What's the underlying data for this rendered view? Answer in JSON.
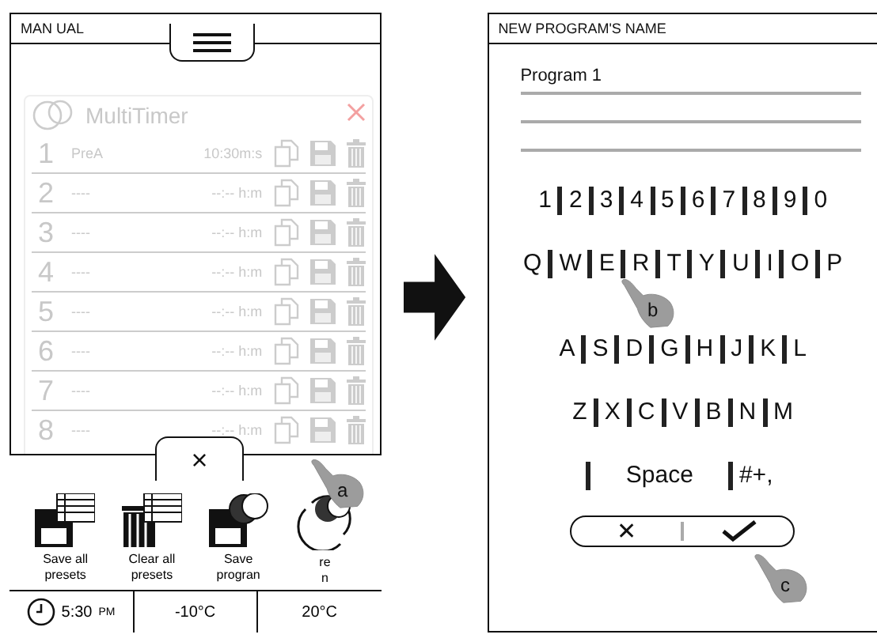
{
  "left_screen": {
    "title": "MAN UAL",
    "timer_card": {
      "title": "MultiTimer",
      "rows": [
        {
          "number": "1",
          "name": "PreA",
          "time": "10:30m:s"
        },
        {
          "number": "2",
          "name": "----",
          "time": "--:-- h:m"
        },
        {
          "number": "3",
          "name": "----",
          "time": "--:-- h:m"
        },
        {
          "number": "4",
          "name": "----",
          "time": "--:-- h:m"
        },
        {
          "number": "5",
          "name": "----",
          "time": "--:-- h:m"
        },
        {
          "number": "6",
          "name": "----",
          "time": "--:-- h:m"
        },
        {
          "number": "7",
          "name": "----",
          "time": "--:-- h:m"
        },
        {
          "number": "8",
          "name": "----",
          "time": "--:-- h:m"
        }
      ]
    },
    "drawer": {
      "close": "×",
      "actions": [
        {
          "kind": "save-presets",
          "lines": [
            "Save all",
            "presets"
          ]
        },
        {
          "kind": "clear-presets",
          "lines": [
            "Clear all",
            "presets"
          ]
        },
        {
          "kind": "save-program",
          "lines": [
            "Save",
            "progran"
          ]
        },
        {
          "kind": "restore",
          "lines": [
            "re",
            "n"
          ]
        }
      ]
    },
    "status_bar": {
      "time": "5:30",
      "time_suffix": "PM",
      "temp_1": "-10°C",
      "temp_2": "20°C"
    }
  },
  "right_screen": {
    "title": "NEW PROGRAM'S NAME",
    "name_value": "Program 1",
    "key_rows": [
      [
        "1",
        "2",
        "3",
        "4",
        "5",
        "6",
        "7",
        "8",
        "9",
        "0"
      ],
      [
        "Q",
        "W",
        "E",
        "R",
        "T",
        "Y",
        "U",
        "I",
        "O",
        "P"
      ],
      [
        "A",
        "S",
        "D",
        "G",
        "H",
        "J",
        "K",
        "L"
      ],
      [
        "Z",
        "X",
        "C",
        "V",
        "B",
        "N",
        "M"
      ]
    ],
    "space_key": "Space",
    "symbols_key": "#+,",
    "cancel": "✕"
  },
  "hands": [
    {
      "label": "a"
    },
    {
      "label": "b"
    },
    {
      "label": "c"
    }
  ]
}
